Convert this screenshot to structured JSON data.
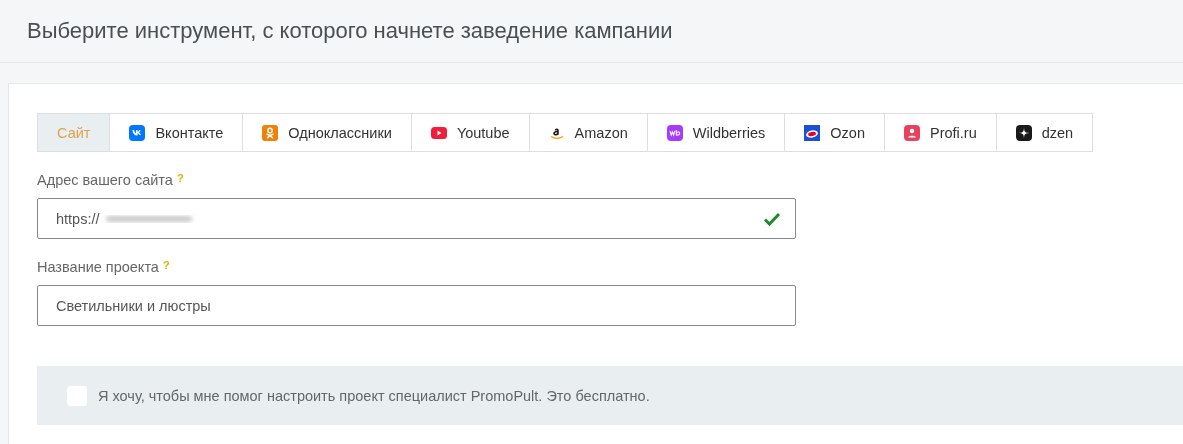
{
  "heading": "Выберите инструмент, с которого начнете заведение кампании",
  "tabs": [
    {
      "label": "Сайт",
      "kind": "site",
      "selected": true
    },
    {
      "label": "Вконтакте",
      "kind": "vk",
      "selected": false
    },
    {
      "label": "Одноклассники",
      "kind": "ok",
      "selected": false
    },
    {
      "label": "Youtube",
      "kind": "youtube",
      "selected": false
    },
    {
      "label": "Amazon",
      "kind": "amazon",
      "selected": false
    },
    {
      "label": "Wildberries",
      "kind": "wb",
      "selected": false
    },
    {
      "label": "Ozon",
      "kind": "ozon",
      "selected": false
    },
    {
      "label": "Profi.ru",
      "kind": "profi",
      "selected": false
    },
    {
      "label": "dzen",
      "kind": "dzen",
      "selected": false
    }
  ],
  "fields": [
    {
      "label": "Адрес вашего сайта",
      "help": "?",
      "value": "https://",
      "redacted": true,
      "valid": true
    },
    {
      "label": "Название проекта",
      "help": "?",
      "value": "Светильники и люстры",
      "redacted": false,
      "valid": false
    }
  ],
  "consent": {
    "text": "Я хочу, чтобы мне помог настроить проект специалист PromoPult. Это бесплатно.",
    "checked": false
  }
}
